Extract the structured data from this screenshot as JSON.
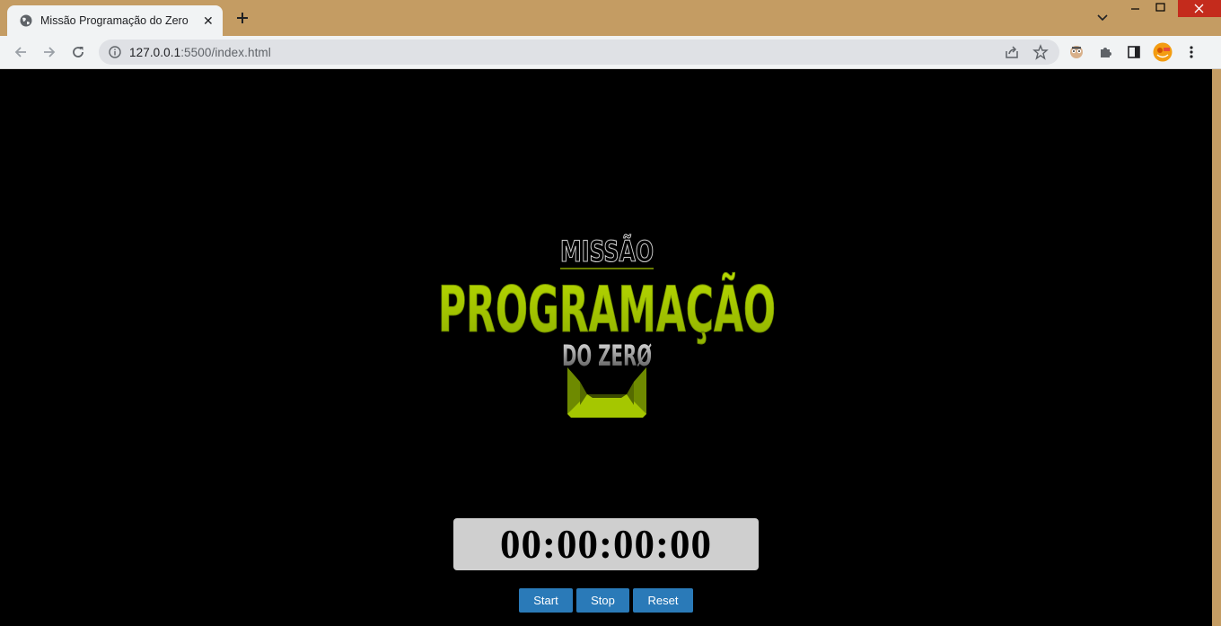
{
  "browser": {
    "tab_title": "Missão Programação do Zero",
    "tab_close": "✕",
    "url_host": "127.0.0.1",
    "url_rest": ":5500/index.html",
    "icons": [
      "globe-icon",
      "plus-icon",
      "chevron-down-icon",
      "minimize-icon",
      "maximize-icon",
      "close-icon",
      "back-icon",
      "forward-icon",
      "reload-icon",
      "info-icon",
      "share-icon",
      "star-icon",
      "extension-icon",
      "puzzle-icon",
      "sidepanel-icon",
      "profile-avatar",
      "menu-icon"
    ]
  },
  "logo": {
    "line1": "MISSÃO",
    "line2": "PROGRAMAÇÃO",
    "line3": "DO ZERØ",
    "colors": {
      "green": "#a5c700",
      "dark_green": "#6e8a00",
      "gray": "#bdbdbd"
    }
  },
  "timer": {
    "display": "00:00:00:00"
  },
  "controls": {
    "start": "Start",
    "stop": "Stop",
    "reset": "Reset",
    "color": "#2a7ab8"
  }
}
